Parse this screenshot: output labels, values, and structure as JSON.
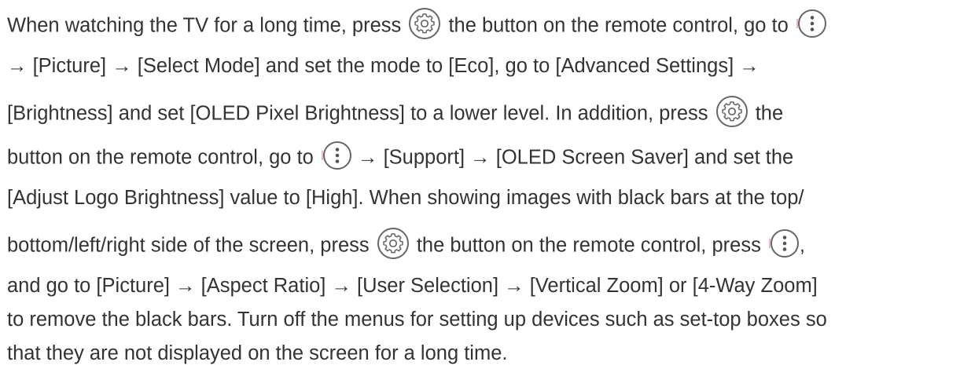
{
  "paragraph": {
    "l1_a": "When watching the TV for a long time, press ",
    "l1_b": " the button on the remote control, go to ",
    "l2": "→ [Picture] → [Select Mode] and set the mode to [Eco], go to [Advanced Settings] →",
    "l3_a": "[Brightness] and set [OLED Pixel Brightness] to a lower level. In addition, press ",
    "l3_b": " the",
    "l4_a": "button on the remote control, go to ",
    "l4_b": " → [Support] → [OLED Screen Saver] and set the",
    "l5": "[Adjust Logo Brightness] value to [High]. When showing images with black bars at the top/",
    "l6_a": "bottom/left/right side of the screen, press ",
    "l6_b": " the button on the remote control, press ",
    "l6_c": ",",
    "l7": "and go to [Picture] → [Aspect Ratio] → [User Selection] → [Vertical Zoom] or [4-Way Zoom]",
    "l8": "to remove the black bars. Turn off the menus for setting up devices such as set-top boxes so",
    "l9": "that they are not displayed on the screen for a long time."
  },
  "icons": {
    "settings": "settings-gear-icon",
    "more": "more-options-icon"
  }
}
